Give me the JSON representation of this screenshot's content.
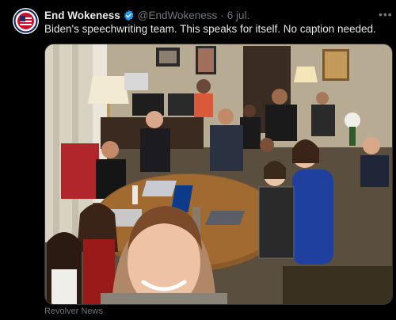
{
  "post": {
    "author_name": "End Wokeness",
    "handle": "@EndWokeness",
    "separator": "·",
    "date": "6 jul.",
    "more_icon": "more-icon",
    "text": "Biden's speechwriting team. This speaks for itself. No caption needed.",
    "media_alt": "Group selfie of a team seated around a round conference table in an office",
    "media_credit": "Revolver News",
    "verified_icon": "verified-badge-icon",
    "brand_color": "#1d9bf0"
  }
}
